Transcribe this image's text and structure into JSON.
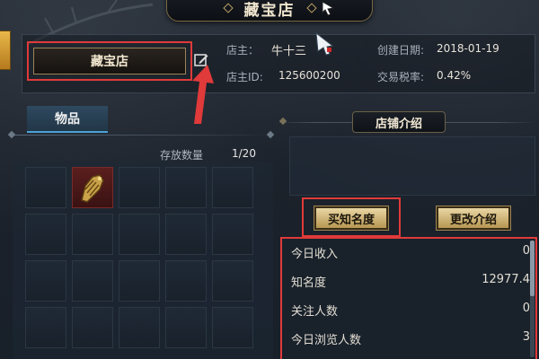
{
  "window": {
    "title": "藏宝店"
  },
  "shop": {
    "name": "藏宝店",
    "owner_label": "店主：",
    "owner_value": "牛十三",
    "owner_id_label": "店主ID:",
    "owner_id_value": "125600200",
    "created_label": "创建日期:",
    "created_value": "2018-01-19",
    "tax_label": "交易税率:",
    "tax_value": "0.42%"
  },
  "items_tab": {
    "label": "物品",
    "storage_label": "存放数量",
    "storage_value": "1/20",
    "grid_slots": [
      {
        "item": ""
      },
      {
        "item": "golden-armor-item"
      },
      {
        "item": ""
      },
      {
        "item": ""
      },
      {
        "item": ""
      },
      {
        "item": ""
      },
      {
        "item": ""
      },
      {
        "item": ""
      },
      {
        "item": ""
      },
      {
        "item": ""
      },
      {
        "item": ""
      },
      {
        "item": ""
      },
      {
        "item": ""
      },
      {
        "item": ""
      },
      {
        "item": ""
      },
      {
        "item": ""
      },
      {
        "item": ""
      },
      {
        "item": ""
      },
      {
        "item": ""
      },
      {
        "item": ""
      }
    ]
  },
  "intro": {
    "title": "店铺介绍",
    "buy_fame_button": "买知名度",
    "edit_intro_button": "更改介绍"
  },
  "stats": [
    {
      "label": "今日收入",
      "value": "0"
    },
    {
      "label": "知名度",
      "value": "12977.4"
    },
    {
      "label": "关注人数",
      "value": "0"
    },
    {
      "label": "今日浏览人数",
      "value": "3"
    }
  ],
  "icons": {
    "edit": "edit-icon",
    "cursor": "sword-cursor-icon",
    "item": "golden-armor-icon"
  },
  "colors": {
    "annotation_red": "#e03a3a",
    "gold_button": "#d8c08a",
    "tab_accent": "#4aa2d8"
  }
}
